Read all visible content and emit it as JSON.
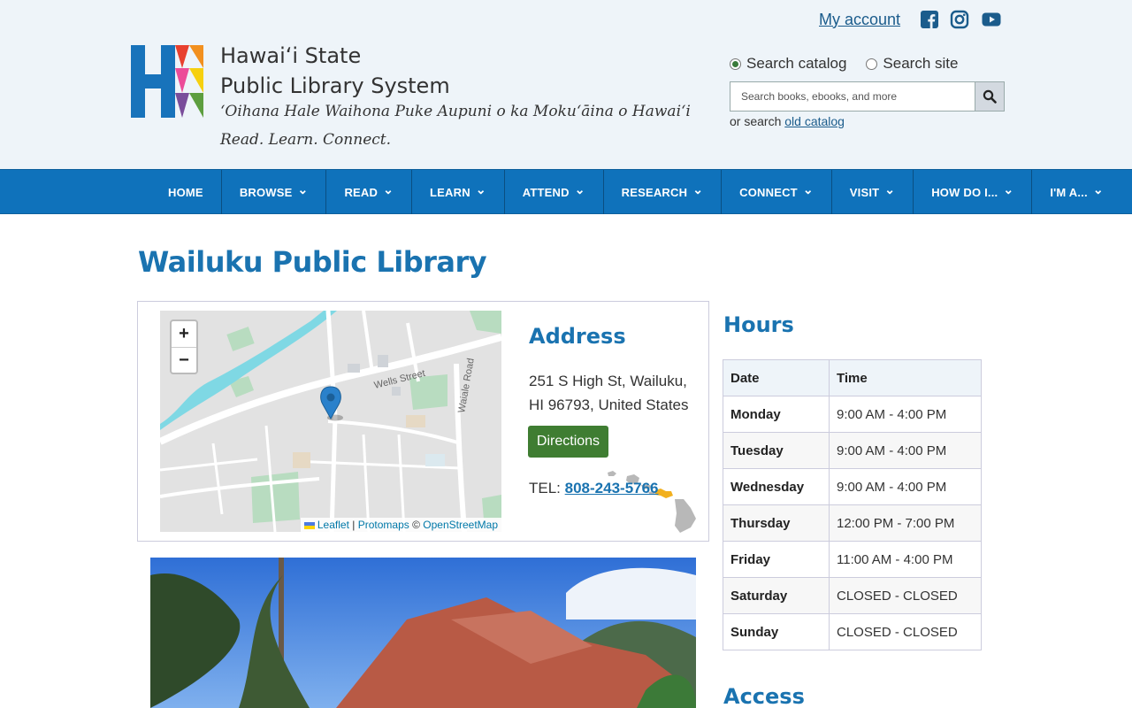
{
  "header": {
    "site_name_line1": "Hawaiʻi State",
    "site_name_line2": "Public Library System",
    "tagline": "ʻOihana Hale Waihona Puke Aupuni o ka Mokuʻāina o Hawaiʻi",
    "motto": "Read. Learn. Connect.",
    "account_link": "My account",
    "social": [
      "facebook-icon",
      "instagram-icon",
      "youtube-icon"
    ],
    "search": {
      "option_catalog": "Search catalog",
      "option_site": "Search site",
      "selected": "catalog",
      "placeholder": "Search books, ebooks, and more",
      "old_catalog_prefix": "or search",
      "old_catalog_link": "old catalog"
    }
  },
  "nav": {
    "items": [
      {
        "label": "HOME",
        "dropdown": false
      },
      {
        "label": "BROWSE",
        "dropdown": true
      },
      {
        "label": "READ",
        "dropdown": true
      },
      {
        "label": "LEARN",
        "dropdown": true
      },
      {
        "label": "ATTEND",
        "dropdown": true
      },
      {
        "label": "RESEARCH",
        "dropdown": true
      },
      {
        "label": "CONNECT",
        "dropdown": true
      },
      {
        "label": "VISIT",
        "dropdown": true
      },
      {
        "label": "HOW DO I...",
        "dropdown": true
      },
      {
        "label": "I'M A...",
        "dropdown": true
      }
    ]
  },
  "page": {
    "title": "Wailuku Public Library"
  },
  "location": {
    "address_heading": "Address",
    "address_line1": "251 S High St, Wailuku,",
    "address_line2": "HI 96793, United States",
    "directions_label": "Directions",
    "tel_prefix": "TEL:",
    "tel_number": "808-243-5766",
    "map": {
      "zoom_in": "+",
      "zoom_out": "−",
      "attrib_leaflet": "Leaflet",
      "attrib_sep": "|",
      "attrib_protomaps": "Protomaps",
      "attrib_copy": "©",
      "attrib_osm": "OpenStreetMap",
      "street_wells": "Wells Street",
      "street_waiale": "Waiale Road"
    }
  },
  "hours": {
    "heading": "Hours",
    "columns": [
      "Date",
      "Time"
    ],
    "rows": [
      {
        "day": "Monday",
        "time": "9:00 AM - 4:00 PM"
      },
      {
        "day": "Tuesday",
        "time": "9:00 AM - 4:00 PM"
      },
      {
        "day": "Wednesday",
        "time": "9:00 AM - 4:00 PM"
      },
      {
        "day": "Thursday",
        "time": "12:00 PM - 7:00 PM"
      },
      {
        "day": "Friday",
        "time": "11:00 AM - 4:00 PM"
      },
      {
        "day": "Saturday",
        "time": "CLOSED - CLOSED"
      },
      {
        "day": "Sunday",
        "time": "CLOSED - CLOSED"
      }
    ]
  },
  "access": {
    "heading": "Access"
  },
  "colors": {
    "nav_blue": "#0f72bb",
    "heading_blue": "#1a73b0",
    "directions_green": "#3f7d32",
    "header_bg": "#eef4f9"
  }
}
